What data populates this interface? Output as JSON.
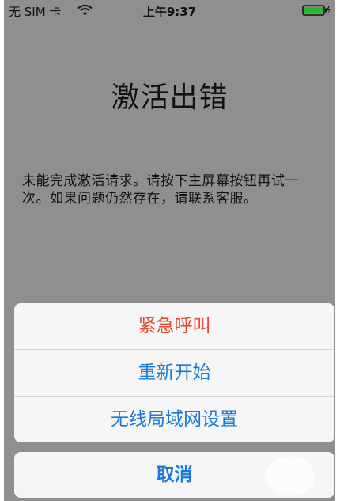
{
  "status_bar": {
    "carrier": "无 SIM 卡",
    "time": "上午9:37",
    "wifi_icon": "wifi-icon",
    "battery_icon": "battery-charging-icon",
    "battery_color": "#2fb62b"
  },
  "title": "激活出错",
  "message": "未能完成激活请求。请按下主屏幕按钮再试一次。如果问题仍然存在，请联系客服。",
  "actions": [
    {
      "label": "紧急呼叫",
      "style": "destructive",
      "color": "#e04a33"
    },
    {
      "label": "重新开始",
      "style": "default",
      "color": "#1a7ad8"
    },
    {
      "label": "无线局域网设置",
      "style": "default",
      "color": "#1a7ad8"
    }
  ],
  "cancel": {
    "label": "取消",
    "color": "#1a7ad8"
  }
}
